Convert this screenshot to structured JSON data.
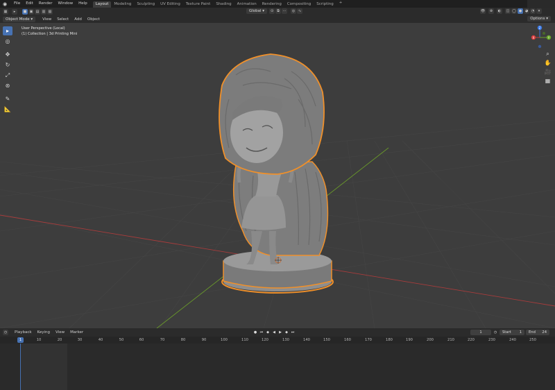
{
  "topbar": {
    "menus": [
      "File",
      "Edit",
      "Render",
      "Window",
      "Help"
    ],
    "workspaces": [
      "Layout",
      "Modeling",
      "Sculpting",
      "UV Editing",
      "Texture Paint",
      "Shading",
      "Animation",
      "Rendering",
      "Compositing",
      "Scripting"
    ],
    "active_workspace": "Layout",
    "add_tab": "+"
  },
  "viewport_header": {
    "mode": "Object Mode",
    "menus": [
      "View",
      "Select",
      "Add",
      "Object"
    ],
    "orientation": "Global",
    "options": "Options"
  },
  "viewport": {
    "view_name": "User Perspective (Local)",
    "collection": "(1) Collection | 3d Printing Mini",
    "colors": {
      "background": "#3d3d3d",
      "x_axis": "#a83c3c",
      "y_axis": "#6a9a2a",
      "selection": "#f0902a",
      "model": "#8a8a8a"
    }
  },
  "gizmo": {
    "z": "Z",
    "y": "Y",
    "x": "X"
  },
  "timeline": {
    "menus": [
      "Playback",
      "Keying",
      "View",
      "Marker"
    ],
    "current_frame": "1",
    "start_label": "Start",
    "start": "1",
    "end_label": "End",
    "end": "24",
    "ruler": [
      "10",
      "20",
      "30",
      "40",
      "50",
      "60",
      "70",
      "80",
      "90",
      "100",
      "110",
      "120",
      "130",
      "140",
      "150",
      "160",
      "170",
      "180",
      "190",
      "200",
      "210",
      "220",
      "230",
      "240",
      "250"
    ],
    "ruler_cursor": "1"
  }
}
